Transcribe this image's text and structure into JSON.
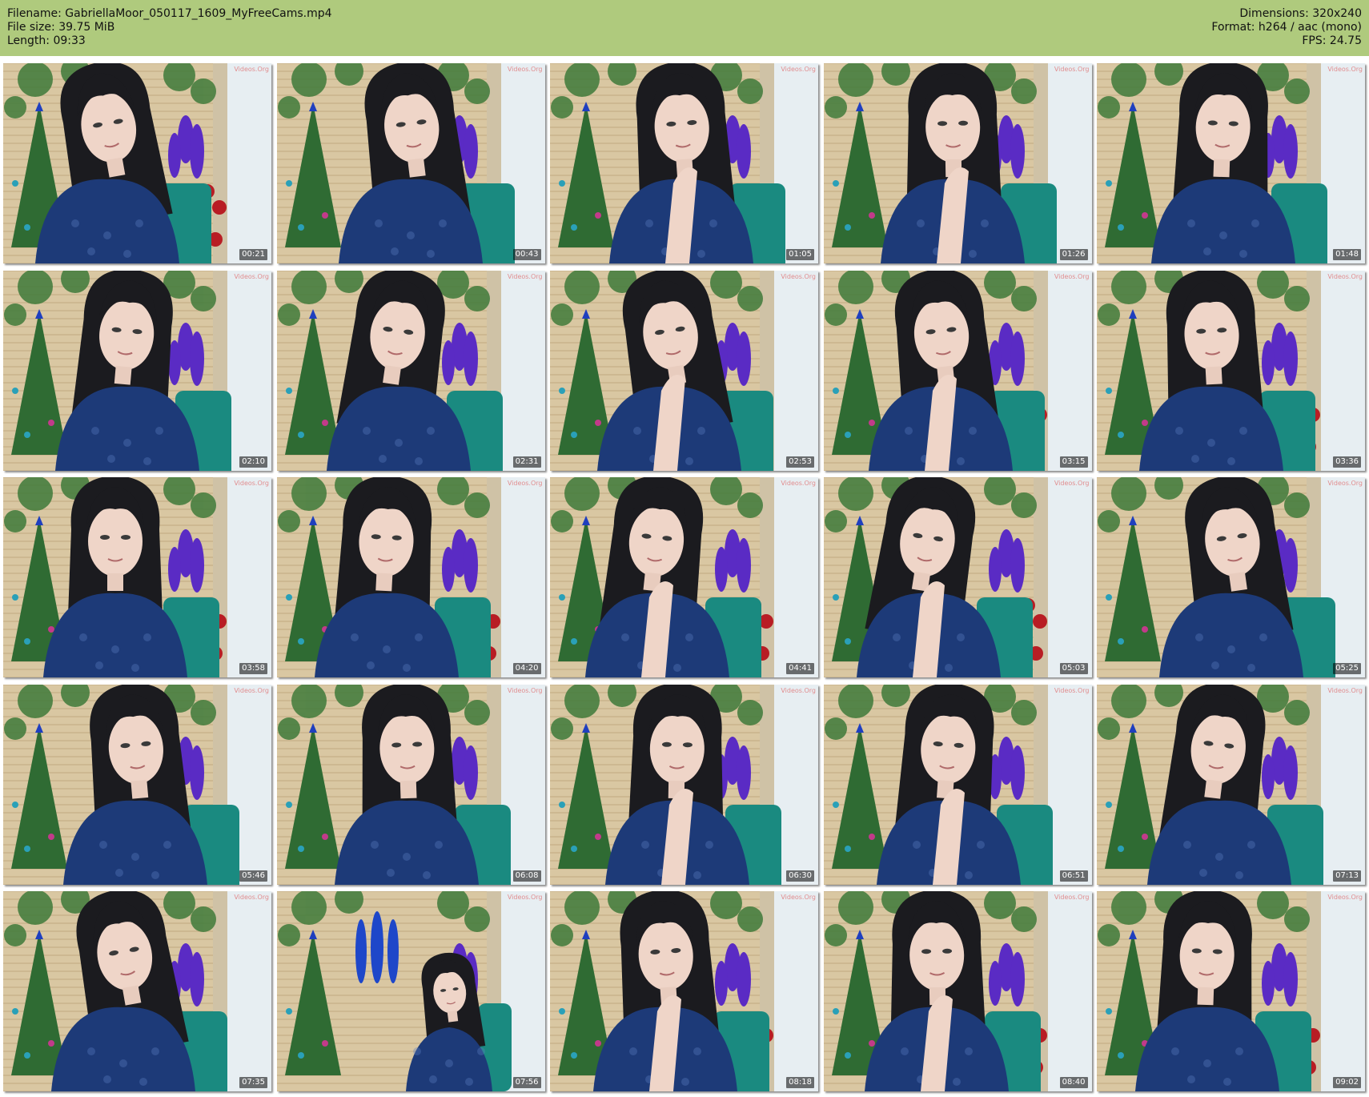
{
  "header": {
    "filename_label": "Filename: GabriellaMoor_050117_1609_MyFreeCams.mp4",
    "filesize_label": "File size: 39.75 MiB",
    "length_label": "Length: 09:33",
    "dimensions_label": "Dimensions: 320x240",
    "format_label": "Format: h264 / aac (mono)",
    "fps_label": "FPS: 24.75"
  },
  "colors": {
    "header_bg": "#afca7d",
    "page_bg": "#ffffff"
  },
  "thumbnails": [
    {
      "timestamp": "00:21",
      "watermark": "Videos.Org"
    },
    {
      "timestamp": "00:43",
      "watermark": "Videos.Org"
    },
    {
      "timestamp": "01:05",
      "watermark": "Videos.Org"
    },
    {
      "timestamp": "01:26",
      "watermark": "Videos.Org"
    },
    {
      "timestamp": "01:48",
      "watermark": "Videos.Org"
    },
    {
      "timestamp": "02:10",
      "watermark": "Videos.Org"
    },
    {
      "timestamp": "02:31",
      "watermark": "Videos.Org"
    },
    {
      "timestamp": "02:53",
      "watermark": "Videos.Org"
    },
    {
      "timestamp": "03:15",
      "watermark": "Videos.Org"
    },
    {
      "timestamp": "03:36",
      "watermark": "Videos.Org"
    },
    {
      "timestamp": "03:58",
      "watermark": "Videos.Org"
    },
    {
      "timestamp": "04:20",
      "watermark": "Videos.Org"
    },
    {
      "timestamp": "04:41",
      "watermark": "Videos.Org"
    },
    {
      "timestamp": "05:03",
      "watermark": "Videos.Org"
    },
    {
      "timestamp": "05:25",
      "watermark": "Videos.Org"
    },
    {
      "timestamp": "05:46",
      "watermark": "Videos.Org"
    },
    {
      "timestamp": "06:08",
      "watermark": "Videos.Org"
    },
    {
      "timestamp": "06:30",
      "watermark": "Videos.Org"
    },
    {
      "timestamp": "06:51",
      "watermark": "Videos.Org"
    },
    {
      "timestamp": "07:13",
      "watermark": "Videos.Org"
    },
    {
      "timestamp": "07:35",
      "watermark": "Videos.Org"
    },
    {
      "timestamp": "07:56",
      "watermark": "Videos.Org"
    },
    {
      "timestamp": "08:18",
      "watermark": "Videos.Org"
    },
    {
      "timestamp": "08:40",
      "watermark": "Videos.Org"
    },
    {
      "timestamp": "09:02",
      "watermark": "Videos.Org"
    }
  ]
}
